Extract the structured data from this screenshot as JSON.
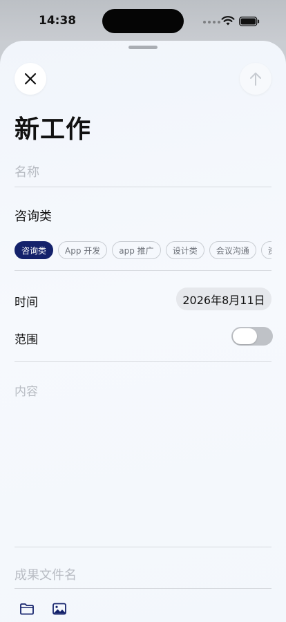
{
  "status_bar": {
    "time": "14:38"
  },
  "sheet": {
    "title": "新工作",
    "close_icon": "xmark-icon",
    "submit_icon": "arrow-up-icon",
    "name_placeholder": "名称",
    "category_value": "咨询类",
    "categories": [
      {
        "label": "咨询类",
        "selected": true
      },
      {
        "label": "App 开发",
        "selected": false
      },
      {
        "label": "app 推广",
        "selected": false
      },
      {
        "label": "设计类",
        "selected": false
      },
      {
        "label": "会议沟通",
        "selected": false
      },
      {
        "label": "资料整理",
        "selected": false
      }
    ],
    "time_label": "时间",
    "date_value": "2026年8月11日",
    "scope_label": "范围",
    "scope_enabled": false,
    "content_placeholder": "内容",
    "file_name_placeholder": "成果文件名",
    "bottom_icons": [
      "folder-icon",
      "photo-icon"
    ]
  },
  "colors": {
    "accent": "#14226b",
    "placeholder": "#b8bcc3",
    "background": "#f3f7fc"
  }
}
